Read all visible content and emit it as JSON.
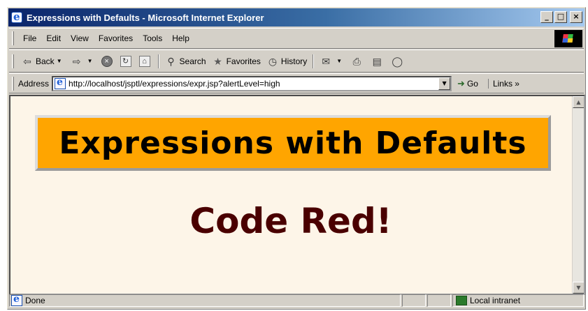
{
  "window": {
    "title": "Expressions with Defaults - Microsoft Internet Explorer",
    "buttons": {
      "minimize": "_",
      "maximize": "□",
      "close": "×"
    }
  },
  "menu": [
    "File",
    "Edit",
    "View",
    "Favorites",
    "Tools",
    "Help"
  ],
  "toolbar": {
    "back_label": "Back",
    "search_label": "Search",
    "favorites_label": "Favorites",
    "history_label": "History"
  },
  "address": {
    "label": "Address",
    "url": "http://localhost/jsptl/expressions/expr.jsp?alertLevel=high",
    "go_label": "Go",
    "links_label": "Links »"
  },
  "page": {
    "heading": "Expressions with Defaults",
    "alert_text": "Code Red!",
    "heading_bg": "#ffa500",
    "alert_color": "#4a0000",
    "background": "#fdf5e8"
  },
  "status": {
    "text": "Done",
    "zone": "Local intranet"
  }
}
